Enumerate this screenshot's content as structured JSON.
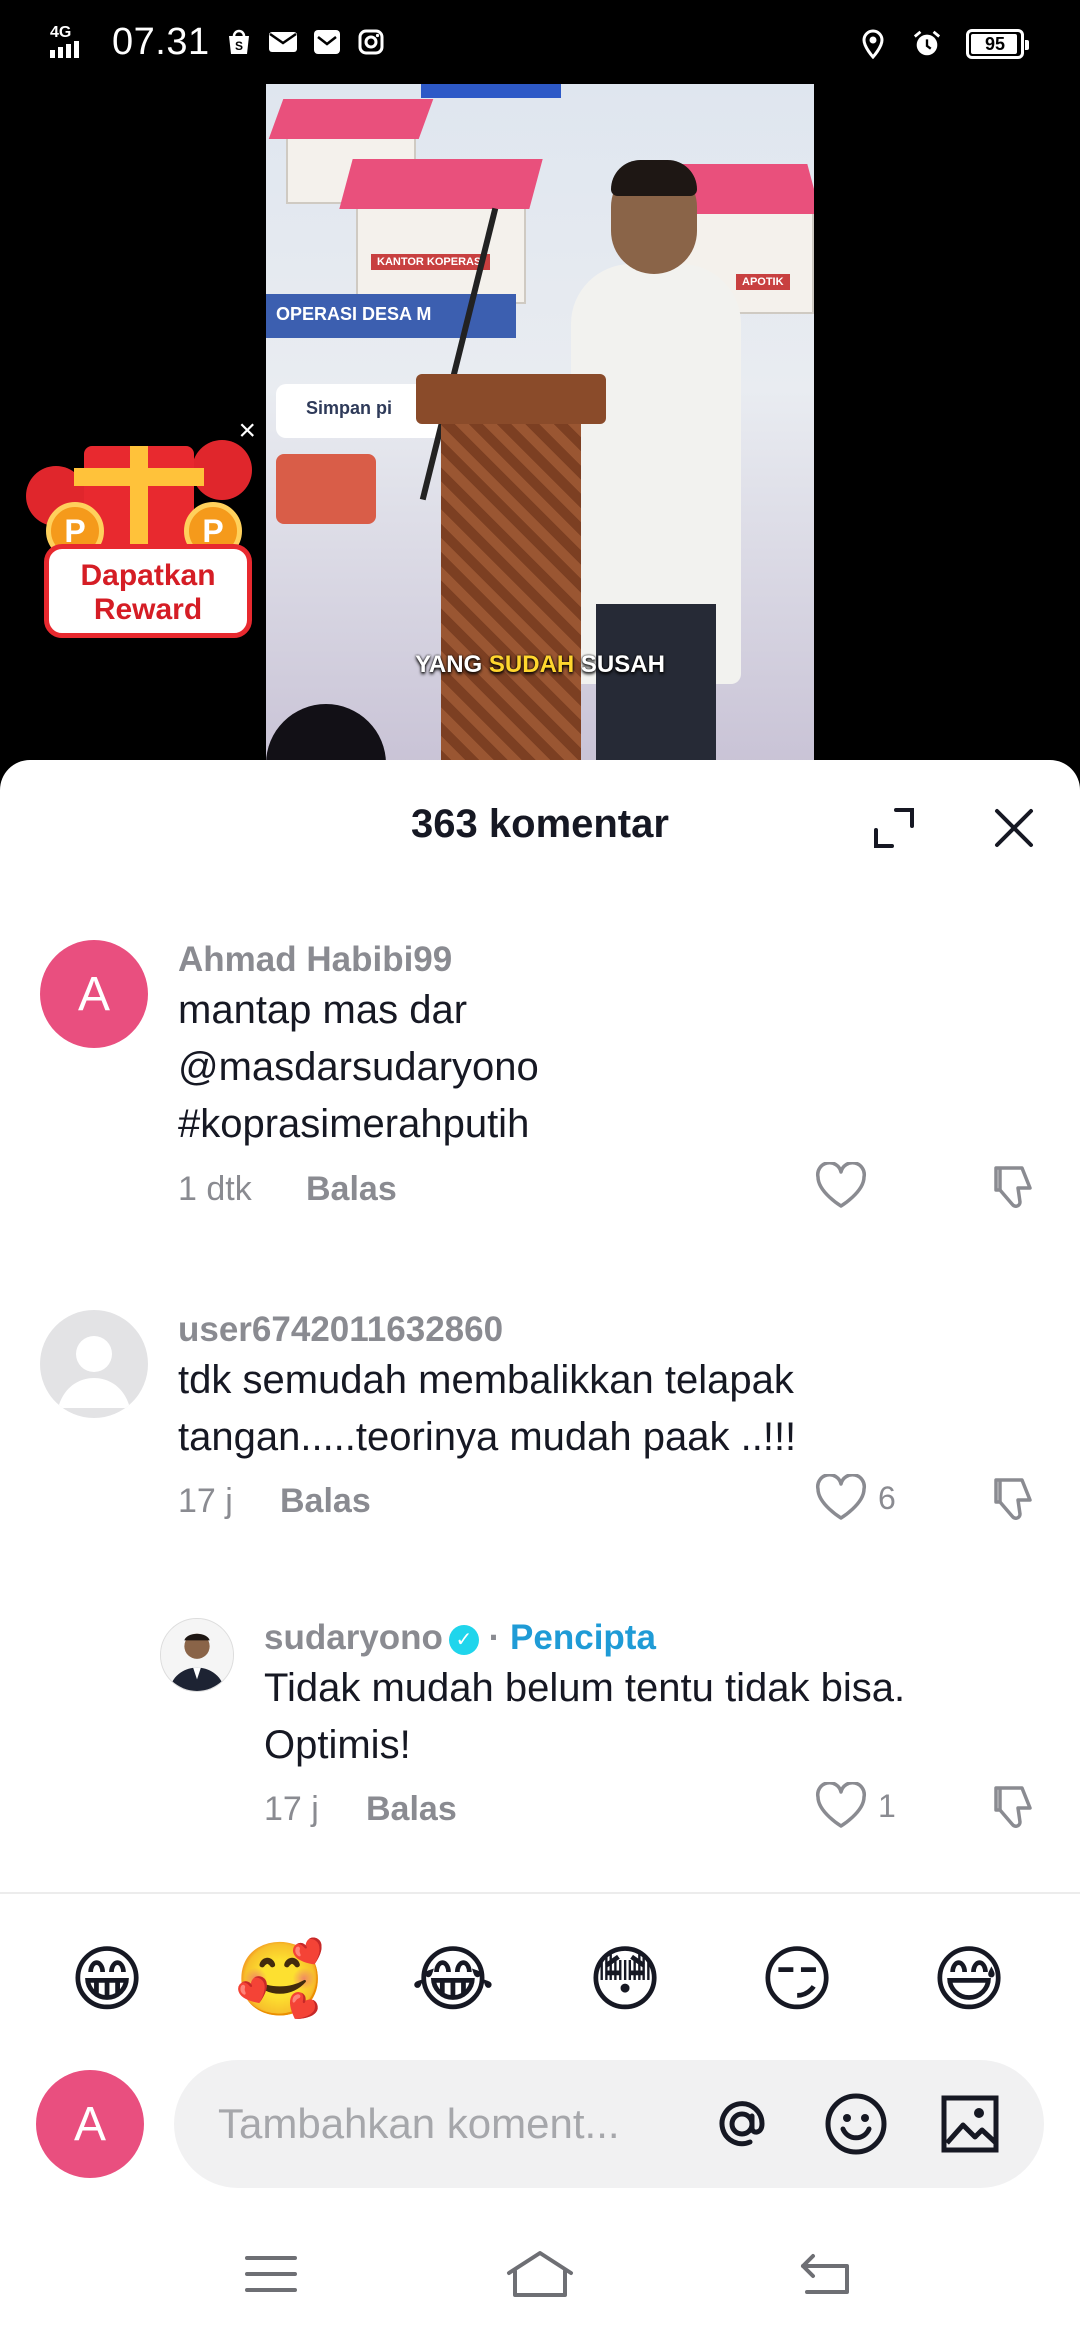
{
  "status_bar": {
    "network": "4G",
    "time": "07.31",
    "battery_level": "95",
    "battery_fraction": 0.95,
    "left_icons": [
      "shopee-bag-icon",
      "mail-icon",
      "mail-alt-icon",
      "instagram-icon"
    ],
    "right_icons": [
      "location-icon",
      "alarm-icon",
      "battery-icon"
    ]
  },
  "video": {
    "caption_pre": "YANG ",
    "caption_highlight": "SUDAH",
    "caption_post": " SUSAH",
    "sign_kantor": "KANTOR KOPERASI",
    "sign_apotik": "APOTIK",
    "banner_text": "OPERASI DESA M",
    "card_text": "Simpan pi",
    "caption_highlight_color": "#ffd62e"
  },
  "reward": {
    "label_line1": "Dapatkan",
    "label_line2": "Reward",
    "coin_letter": "P",
    "close": "×"
  },
  "sheet": {
    "title": "363 komentar"
  },
  "comments": [
    {
      "username": "Ahmad Habibi99",
      "avatar_letter": "A",
      "line1": "mantap mas dar",
      "line2": "@masdarsudaryono",
      "line3": "#koprasimerahputih",
      "time": "1 dtk",
      "reply": "Balas",
      "likes": ""
    },
    {
      "username": "user6742011632860",
      "line1": "tdk semudah membalikkan telapak",
      "line2": "tangan.....teorinya mudah paak ..!!!",
      "time": "17 j",
      "reply": "Balas",
      "likes": "6"
    },
    {
      "username": "sudaryono",
      "badge": "✓",
      "separator": "·",
      "role": "Pencipta",
      "line1": "Tidak mudah belum tentu tidak bisa.",
      "line2": "Optimis!",
      "time": "17 j",
      "reply": "Balas",
      "likes": "1"
    }
  ],
  "emojis": [
    "😁",
    "🥰",
    "😂",
    "😳",
    "😏",
    "😅"
  ],
  "input": {
    "avatar_letter": "A",
    "placeholder": "Tambahkan koment...",
    "icons": [
      "mention-icon",
      "emoji-icon",
      "image-icon"
    ]
  },
  "colors": {
    "avatar_pink": "#e94f7f",
    "creator_blue": "#1f9bd6",
    "verified": "#20d5ec",
    "reward_red": "#e8292f"
  }
}
